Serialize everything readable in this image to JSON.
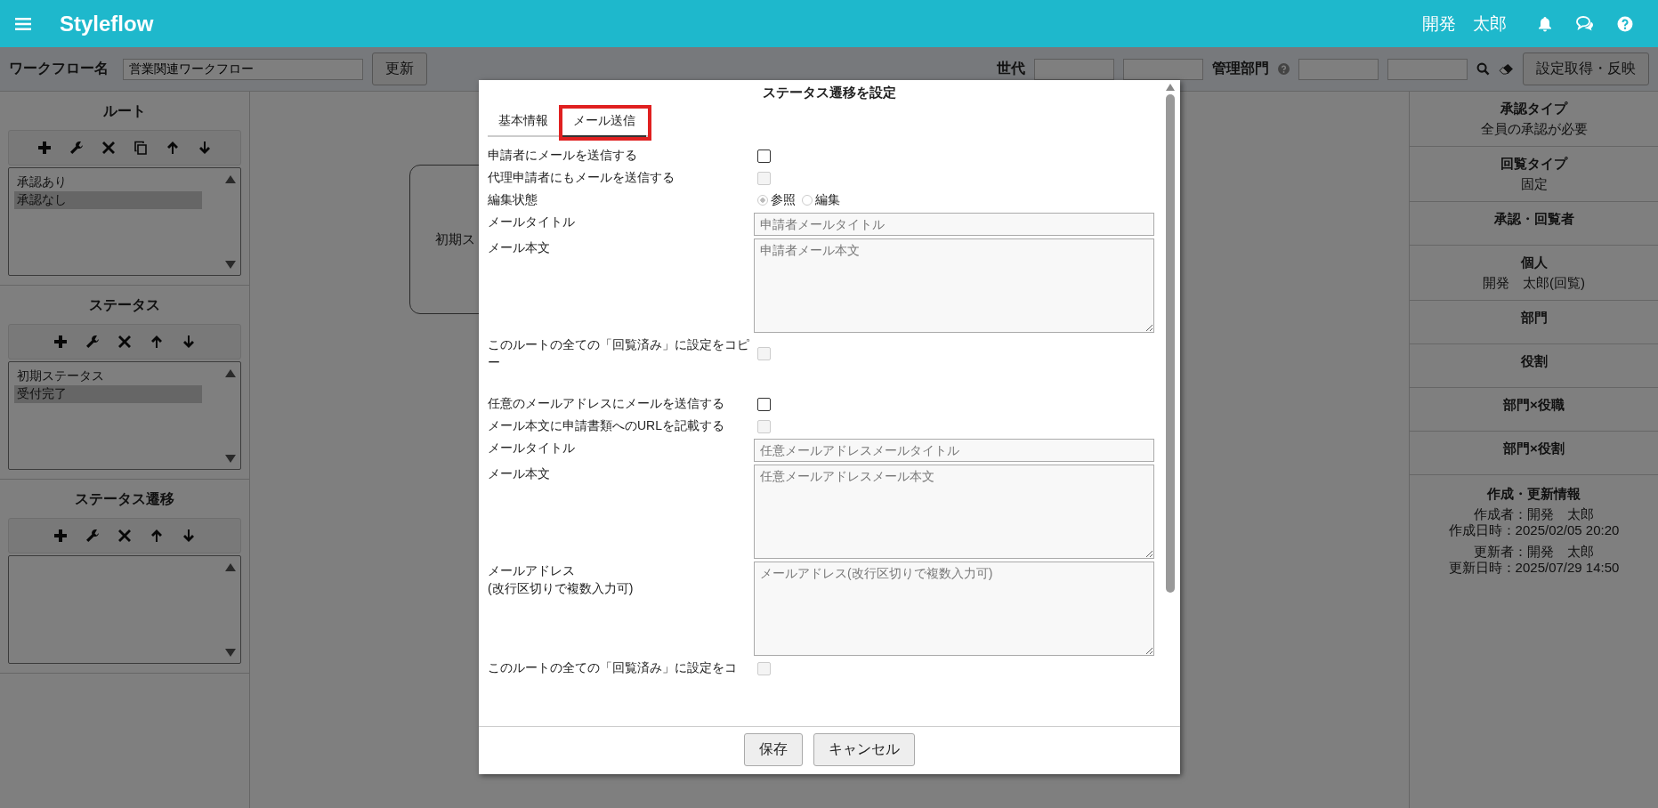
{
  "header": {
    "logo": "Styleflow",
    "user": "開発　太郎"
  },
  "toolbar": {
    "workflow_label": "ワークフロー名",
    "workflow_value": "営業関連ワークフロー",
    "update_button": "更新",
    "generation_label": "世代",
    "department_label": "管理部門",
    "apply_button": "設定取得・反映"
  },
  "left_panel": [
    {
      "title": "ルート",
      "copy_tool": true,
      "items": [
        {
          "label": "承認あり",
          "selected": false
        },
        {
          "label": "承認なし",
          "selected": true
        }
      ]
    },
    {
      "title": "ステータス",
      "copy_tool": false,
      "items": [
        {
          "label": "初期ステータス",
          "selected": false
        },
        {
          "label": "受付完了",
          "selected": true
        }
      ]
    },
    {
      "title": "ステータス遷移",
      "copy_tool": false
    }
  ],
  "canvas": {
    "nodes": [
      {
        "label": "初期ス"
      }
    ]
  },
  "right_panel": [
    {
      "heading": "承認タイプ",
      "lines": [
        "全員の承認が必要"
      ]
    },
    {
      "heading": "回覧タイプ",
      "lines": [
        "固定"
      ]
    },
    {
      "heading": "承認・回覧者"
    },
    {
      "heading": "個人",
      "lines": [
        "開発　太郎(回覧)"
      ]
    },
    {
      "heading": "部門"
    },
    {
      "heading": "役割"
    },
    {
      "heading": "部門×役職"
    },
    {
      "heading": "部門×役割"
    },
    {
      "heading": "作成・更新情報",
      "lines": [
        "作成者：開発　太郎",
        "作成日時：2025/02/05 20:20",
        "更新者：開発　太郎",
        "更新日時：2025/07/29 14:50"
      ]
    }
  ],
  "modal": {
    "title": "ステータス遷移を設定",
    "tabs": [
      {
        "label": "基本情報",
        "selected": false,
        "highlighted": false
      },
      {
        "label": "メール送信",
        "selected": true,
        "highlighted": true
      }
    ],
    "sections": [
      [
        {
          "kind": "checkbox",
          "label": "申請者にメールを送信する",
          "checked": false,
          "disabled": false
        },
        {
          "kind": "checkbox",
          "label": "代理申請者にもメールを送信する",
          "checked": false,
          "disabled": true
        },
        {
          "kind": "radio",
          "label": "編集状態",
          "disabled": true,
          "options": [
            {
              "label": "参照",
              "selected": true
            },
            {
              "label": "編集",
              "selected": false
            }
          ]
        },
        {
          "kind": "text",
          "label": "メールタイトル",
          "placeholder": "申請者メールタイトル"
        },
        {
          "kind": "textarea",
          "label": "メール本文",
          "placeholder": "申請者メール本文"
        },
        {
          "kind": "checkbox",
          "label": "このルートの全ての「回覧済み」に設定をコピー",
          "checked": false,
          "disabled": true
        }
      ],
      [
        {
          "kind": "checkbox",
          "label": "任意のメールアドレスにメールを送信する",
          "checked": false,
          "disabled": false
        },
        {
          "kind": "checkbox",
          "label": "メール本文に申請書類へのURLを記載する",
          "checked": false,
          "disabled": true
        },
        {
          "kind": "text",
          "label": "メールタイトル",
          "placeholder": "任意メールアドレスメールタイトル"
        },
        {
          "kind": "textarea",
          "label": "メール本文",
          "placeholder": "任意メールアドレスメール本文"
        },
        {
          "kind": "textarea",
          "label": "メールアドレス\n(改行区切りで複数入力可)",
          "placeholder": "メールアドレス(改行区切りで複数入力可)"
        },
        {
          "kind": "checkbox",
          "label": "このルートの全ての「回覧済み」に設定をコ",
          "checked": false,
          "disabled": true
        }
      ]
    ],
    "buttons": [
      "保存",
      "キャンセル"
    ]
  }
}
